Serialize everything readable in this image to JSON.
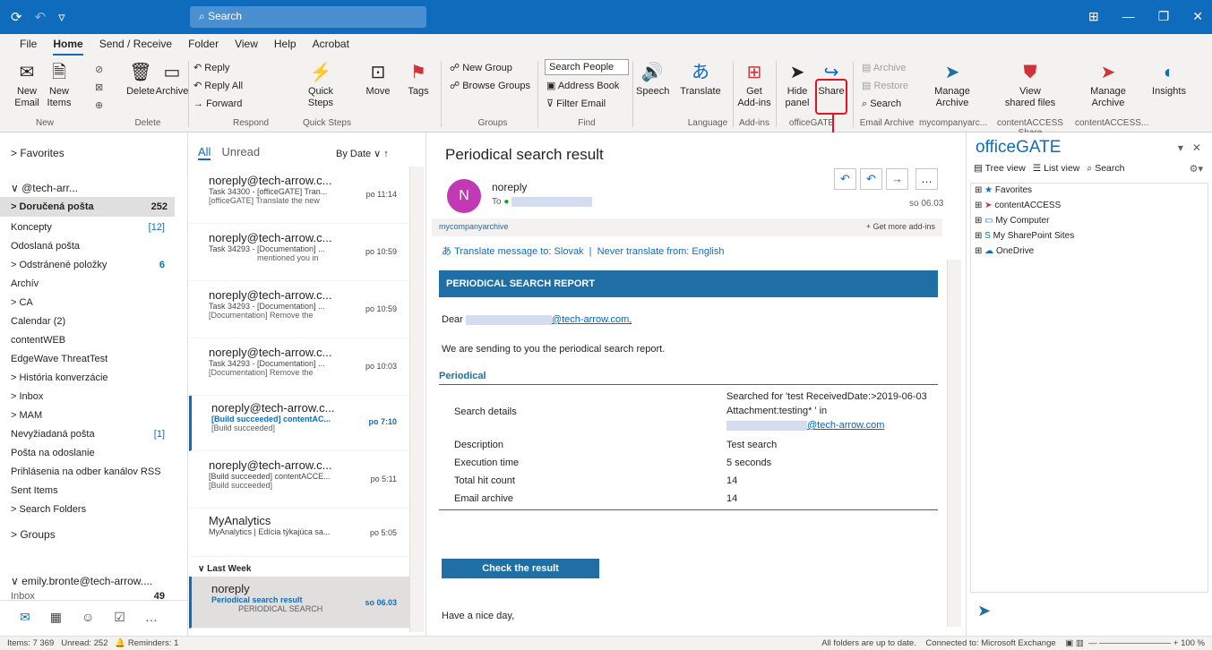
{
  "window": {
    "search_placeholder": "Search"
  },
  "menu": [
    "File",
    "Home",
    "Send / Receive",
    "Folder",
    "View",
    "Help",
    "Acrobat"
  ],
  "ribbon": {
    "new_email": "New\nEmail",
    "new_items": "New\nItems",
    "delete": "Delete",
    "archive": "Archive",
    "reply": "Reply",
    "reply_all": "Reply All",
    "forward": "Forward",
    "quick_steps": "Quick\nSteps",
    "move": "Move",
    "tags": "Tags",
    "new_group": "New Group",
    "browse_groups": "Browse Groups",
    "search_people": "Search People",
    "address_book": "Address Book",
    "filter_email": "Filter Email",
    "speech": "Speech",
    "translate": "Translate",
    "get_addins": "Get\nAdd-ins",
    "hide_panel": "Hide\npanel",
    "share": "Share",
    "ea_archive": "Archive",
    "ea_restore": "Restore",
    "ea_search": "Search",
    "manage_archive": "Manage\nArchive",
    "view_shared": "View\nshared files",
    "manage_archive2": "Manage\nArchive",
    "insights": "Insights",
    "groups": {
      "new": "New",
      "delete": "Delete",
      "respond": "Respond",
      "quick_steps": "Quick Steps",
      "groups": "Groups",
      "find": "Find",
      "language": "Language",
      "addins": "Add-ins",
      "officegate": "officeGATE",
      "email_archive": "Email Archive",
      "mycompany": "mycompanyarc...",
      "ca_share": "contentACCESS Share",
      "ca_arch": "contentACCESS..."
    }
  },
  "folders": {
    "favorites": "> Favorites",
    "account1": "∨ @tech-arr...",
    "items": [
      {
        "label": "> Doručená pošta",
        "count": "252",
        "selected": true
      },
      {
        "label": "Koncepty",
        "count": "[12]"
      },
      {
        "label": "Odoslaná pošta",
        "count": ""
      },
      {
        "label": "> Odstránené položky",
        "count": "6"
      },
      {
        "label": "Archív",
        "count": ""
      },
      {
        "label": "> CA",
        "count": ""
      },
      {
        "label": "Calendar (2)",
        "count": ""
      },
      {
        "label": "contentWEB",
        "count": ""
      },
      {
        "label": "EdgeWave ThreatTest",
        "count": ""
      },
      {
        "label": "> História konverzácie",
        "count": ""
      },
      {
        "label": "> Inbox",
        "count": ""
      },
      {
        "label": "> MAM",
        "count": ""
      },
      {
        "label": "Nevyžiadaná pošta",
        "count": "[1]"
      },
      {
        "label": "Pošta na odoslanie",
        "count": ""
      },
      {
        "label": "Prihlásenia na odber kanálov RSS",
        "count": ""
      },
      {
        "label": "Sent Items",
        "count": ""
      },
      {
        "label": "> Search Folders",
        "count": ""
      },
      {
        "label": "> Groups",
        "count": ""
      }
    ],
    "account2": "∨ emily.bronte@tech-arrow....",
    "inbox2": "Inbox",
    "inbox2_count": "49"
  },
  "list": {
    "tab_all": "All",
    "tab_unread": "Unread",
    "sort": "By Date ∨  ↑",
    "mails": [
      {
        "from": "noreply@tech-arrow.c...",
        "subj": "Task 34300 - [officeGATE] Tran...",
        "prev": "[officeGATE] Translate the new",
        "time": "po 11:14"
      },
      {
        "from": "noreply@tech-arrow.c...",
        "subj": "Task 34293 - [Documentation] ...",
        "prev": "mentioned you in",
        "time": "po 10:59"
      },
      {
        "from": "noreply@tech-arrow.c...",
        "subj": "Task 34293 - [Documentation] ...",
        "prev": "[Documentation] Remove the",
        "time": "po 10:59"
      },
      {
        "from": "noreply@tech-arrow.c...",
        "subj": "Task 34293 - [Documentation] ...",
        "prev": "[Documentation] Remove the",
        "time": "po 10:03"
      },
      {
        "from": "noreply@tech-arrow.c...",
        "subj": "[Build succeeded] contentAC...",
        "prev": "[Build succeeded]",
        "time": "po 7:10",
        "unread": true
      },
      {
        "from": "noreply@tech-arrow.c...",
        "subj": "[Build succeeded] contentACCE...",
        "prev": "[Build succeeded]",
        "time": "po 5:11"
      },
      {
        "from": "MyAnalytics",
        "subj": "MyAnalytics | Edícia týkajúca sa...",
        "prev": "",
        "time": "po 5:05"
      }
    ],
    "last_week": "∨  Last Week",
    "sel_mail": {
      "from": "noreply",
      "subj": "Periodical search result",
      "prev": "PERIODICAL SEARCH",
      "time": "so 06.03"
    }
  },
  "reading": {
    "title": "Periodical search result",
    "avatar": "N",
    "sender": "noreply",
    "to": "To",
    "date": "so 06.03",
    "addin": "mycompanyarchive",
    "get_more": "+ Get more add-ins",
    "translate": "Translate message to: Slovak",
    "never": "Never translate from: English",
    "report_title": "PERIODICAL SEARCH REPORT",
    "dear": "Dear",
    "dear_email": "@tech-arrow.com,",
    "intro": "We are sending to you the periodical search report.",
    "periodical": "Periodical",
    "labels": [
      "Search details",
      "Description",
      "Execution time",
      "Total hit count",
      "Email archive"
    ],
    "search_details": "Searched for 'test ReceivedDate:>2019-06-03 Attachment:testing* ' in",
    "sd_email": "@tech-arrow.com",
    "values": [
      "Test search",
      "5 seconds",
      "14",
      "14"
    ],
    "check": "Check the result",
    "bye": "Have a nice day,"
  },
  "officegate": {
    "title": "officeGATE",
    "tree_view": "Tree view",
    "list_view": "List view",
    "search": "Search",
    "nodes": [
      "Favorites",
      "contentACCESS",
      "My Computer",
      "My SharePoint Sites",
      "OneDrive"
    ]
  },
  "status": {
    "items": "Items: 7 369",
    "unread": "Unread: 252",
    "reminders": "Reminders: 1",
    "sync": "All folders are up to date.",
    "conn": "Connected to: Microsoft Exchange",
    "zoom": "100 %"
  }
}
